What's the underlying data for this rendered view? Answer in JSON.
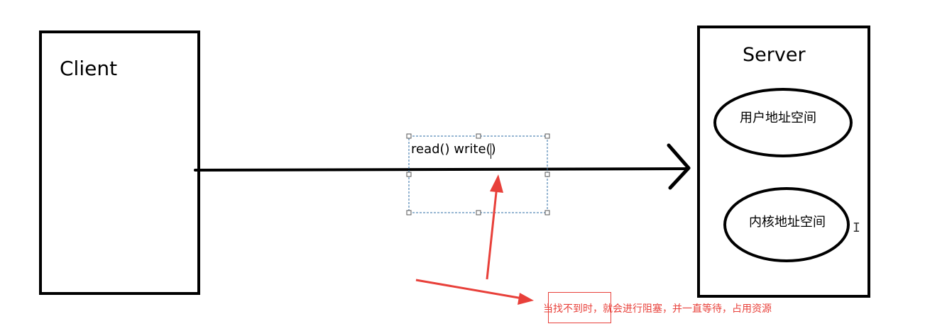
{
  "diagram": {
    "client_label": "Client",
    "server_label": "Server",
    "user_space_label": "用户地址空间",
    "kernel_space_label": "内核地址空间",
    "call_label": "read() write()",
    "caption": "当找不到时，就会进行阻塞，并一直等待，占用资源"
  },
  "colors": {
    "stroke": "#000000",
    "annotation": "#e8403a",
    "selection": "#2e6da4"
  },
  "icons": {
    "cursor": "text-cursor-icon"
  }
}
